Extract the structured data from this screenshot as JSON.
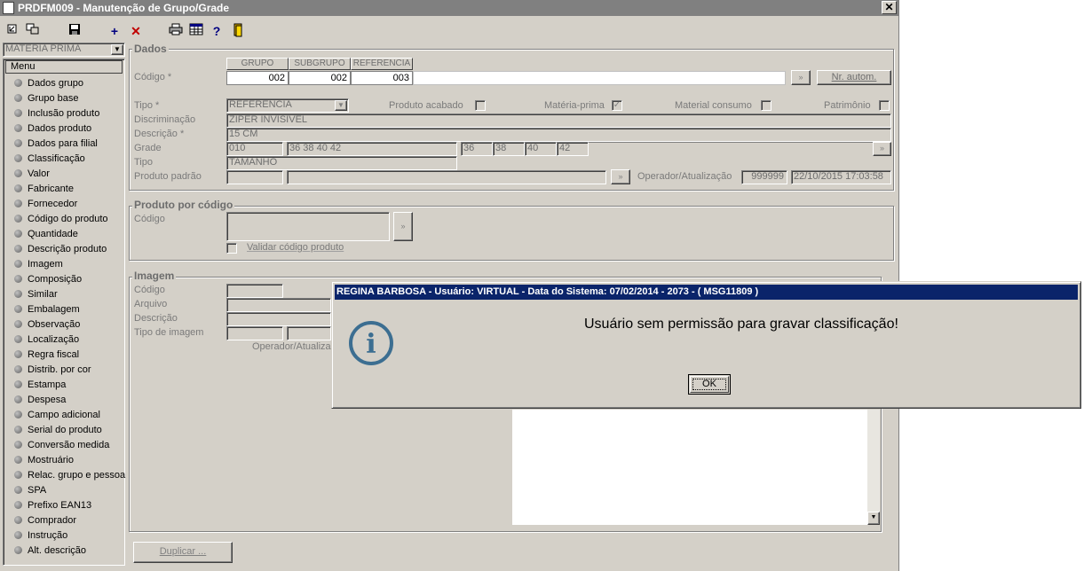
{
  "window": {
    "title": "PRDFM009 - Manutenção de Grupo/Grade",
    "close": "✕"
  },
  "toolbar": {
    "add": "+",
    "delete": "✕",
    "help": "?"
  },
  "sidebar": {
    "combo_value": "MATERIA PRIMA",
    "menu_header": "Menu",
    "items": [
      "Dados grupo",
      "Grupo base",
      "Inclusão produto",
      "Dados produto",
      "Dados para filial",
      "Classificação",
      "Valor",
      "Fabricante",
      "Fornecedor",
      "Código do produto",
      "Quantidade",
      "Descrição produto",
      "Imagem",
      "Composição",
      "Similar",
      "Embalagem",
      "Observação",
      "Localização",
      "Regra fiscal",
      "Distrib. por cor",
      "Estampa",
      "Despesa",
      "Campo adicional",
      "Serial do produto",
      "Conversão medida",
      "Mostruário",
      "Relac. grupo e pessoa",
      "SPA",
      "Prefixo EAN13",
      "Comprador",
      "Instrução",
      "Alt. descrição"
    ]
  },
  "dados": {
    "title": "Dados",
    "col_grupo": "GRUPO",
    "col_subgrupo": "SUBGRUPO",
    "col_referencia": "REFERENCIA",
    "codigo_label": "Código *",
    "grupo_value": "002",
    "subgrupo_value": "002",
    "referencia_value": "003",
    "nr_autom_label": "Nr. autom.",
    "tipo_label": "Tipo *",
    "tipo_value": "REFERENCIA",
    "produto_acabado_label": "Produto acabado",
    "materia_prima_label": "Matéria-prima",
    "material_consumo_label": "Material consumo",
    "patrimonio_label": "Patrimônio",
    "discriminacao_label": "Discriminação",
    "discriminacao_value": "ZIPER INVISIVEL",
    "descricao_label": "Descrição *",
    "descricao_value": "15 CM",
    "grade_label": "Grade",
    "grade_code": "010",
    "grade_sizes": "36 38 40 42",
    "grade_s1": "36",
    "grade_s2": "38",
    "grade_s3": "40",
    "grade_s4": "42",
    "tipo2_label": "Tipo",
    "tipo2_value": "TAMANHO",
    "produto_padrao_label": "Produto padrão",
    "operador_label": "Operador/Atualização",
    "operador_value": "999999",
    "atualizacao_value": "22/10/2015 17:03:58"
  },
  "produto_codigo": {
    "title": "Produto por código",
    "codigo_label": "Código",
    "validar_label": "Validar código produto"
  },
  "imagem": {
    "title": "Imagem",
    "codigo_label": "Código",
    "arquivo_label": "Arquivo",
    "descricao_label": "Descrição",
    "tipo_label": "Tipo de imagem",
    "operador_label": "Operador/Atualiza"
  },
  "footer": {
    "duplicar_label": "Duplicar ..."
  },
  "dialog": {
    "title": "REGINA BARBOSA - Usuário: VIRTUAL - Data do Sistema: 07/02/2014 - 2073 - ( MSG11809 )",
    "message": "Usuário sem permissão para gravar classificação!",
    "icon_glyph": "i",
    "ok_label": "OK"
  },
  "colors": {
    "window_bg": "#d4d0c8",
    "dialog_title_bg": "#0a246a",
    "info_icon": "#3c6e91"
  }
}
